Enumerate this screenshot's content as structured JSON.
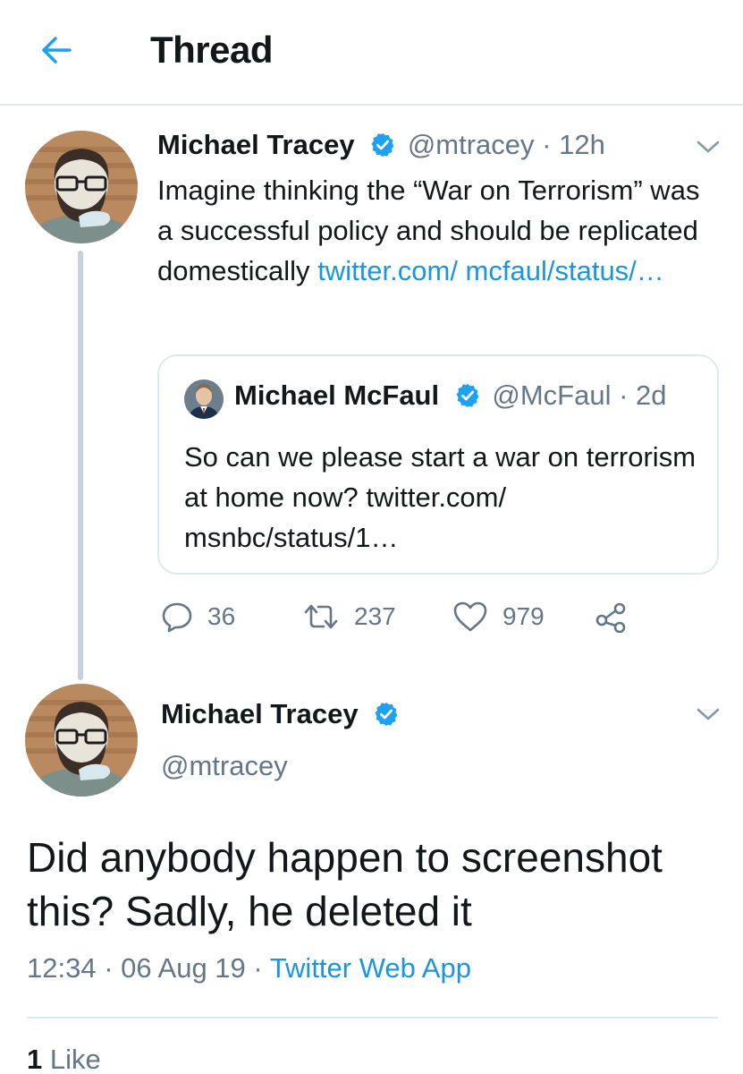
{
  "header": {
    "title": "Thread"
  },
  "tweet1": {
    "name": "Michael Tracey",
    "handle": "@mtracey",
    "separator": "·",
    "time": "12h",
    "text_plain": "Imagine thinking the “War on Terrorism” was a successful policy and should be replicated domestically ",
    "text_link": "twitter.com/ mcfaul/status/…",
    "quote": {
      "name": "Michael McFaul",
      "handle": "@McFaul",
      "separator": "·",
      "time": "2d",
      "text": "So can we please start a war on terrorism at home now? twitter.com/ msnbc/status/1…"
    },
    "actions": {
      "replies": "36",
      "retweets": "237",
      "likes": "979"
    }
  },
  "tweet2": {
    "name": "Michael Tracey",
    "handle": "@mtracey",
    "text": "Did anybody happen to screenshot this? Sadly, he deleted it",
    "time": "12:34",
    "separator1": "·",
    "date": "06 Aug 19",
    "separator2": "·",
    "app": "Twitter Web App",
    "like_count": "1",
    "like_label": "Like"
  },
  "icons": {
    "back": "arrow-left-icon",
    "verified": "verified-badge-icon",
    "caret": "chevron-down-icon",
    "reply": "reply-icon",
    "retweet": "retweet-icon",
    "like": "heart-icon",
    "share": "share-icon"
  },
  "colors": {
    "accent": "#1da1f2",
    "link": "#1b95e0",
    "secondary_text": "#657786",
    "border": "#e1e8ed"
  }
}
